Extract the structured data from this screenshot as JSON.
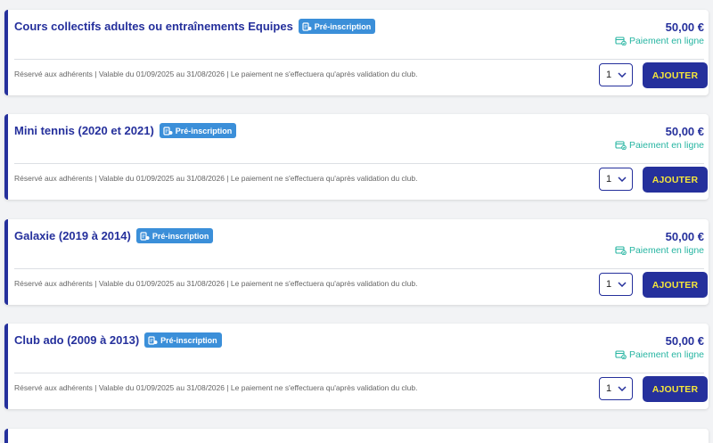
{
  "items": [
    {
      "title": "Cours collectifs adultes ou entraînements Equipes",
      "badge": "Pré-inscription",
      "price": "50,00 €",
      "payment": "Paiement en ligne",
      "description": "Réservé aux adhérents | Valable du 01/09/2025 au 31/08/2026 | Le paiement ne s'effectuera qu'après validation du club.",
      "quantity": "1",
      "add_label": "AJOUTER"
    },
    {
      "title": "Mini tennis (2020 et 2021)",
      "badge": "Pré-inscription",
      "price": "50,00 €",
      "payment": "Paiement en ligne",
      "description": "Réservé aux adhérents | Valable du 01/09/2025 au 31/08/2026 | Le paiement ne s'effectuera qu'après validation du club.",
      "quantity": "1",
      "add_label": "AJOUTER"
    },
    {
      "title": "Galaxie (2019 à 2014)",
      "badge": "Pré-inscription",
      "price": "50,00 €",
      "payment": "Paiement en ligne",
      "description": "Réservé aux adhérents | Valable du 01/09/2025 au 31/08/2026 | Le paiement ne s'effectuera qu'après validation du club.",
      "quantity": "1",
      "add_label": "AJOUTER"
    },
    {
      "title": "Club ado (2009 à 2013)",
      "badge": "Pré-inscription",
      "price": "50,00 €",
      "payment": "Paiement en ligne",
      "description": "Réservé aux adhérents | Valable du 01/09/2025 au 31/08/2026 | Le paiement ne s'effectuera qu'après validation du club.",
      "quantity": "1",
      "add_label": "AJOUTER"
    }
  ],
  "colors": {
    "primary": "#25309c",
    "accent_text": "#f5e63a",
    "badge": "#3b8fd9",
    "payment": "#27b5a2"
  },
  "icons": {
    "badge": "document-pen-icon",
    "payment": "card-check-icon",
    "quantity": "chevron-down-icon"
  }
}
